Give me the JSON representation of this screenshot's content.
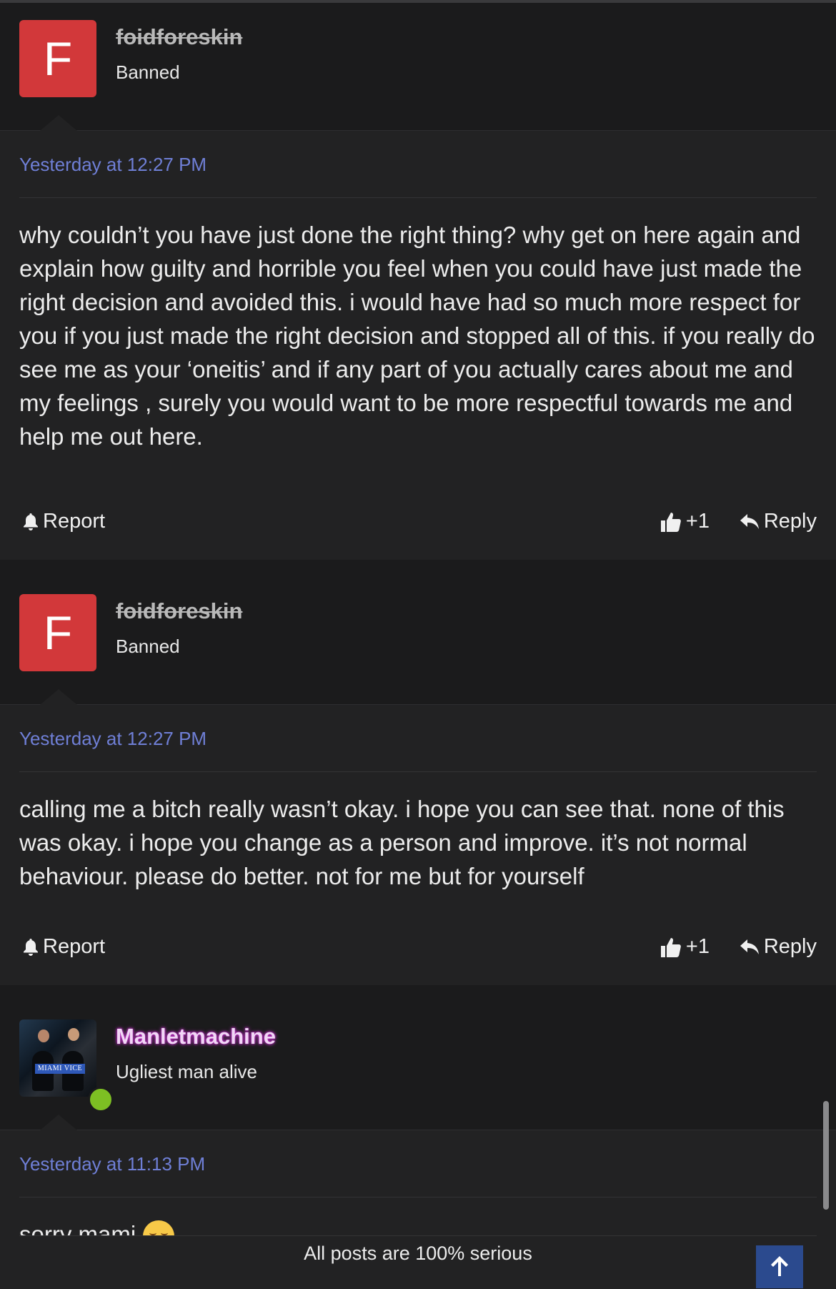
{
  "posts": [
    {
      "avatar_letter": "F",
      "username": "foidforeskin",
      "user_title": "Banned",
      "timestamp": "Yesterday at 12:27 PM",
      "body": "why couldn’t you have just done the right thing? why get on here again and explain how guilty and horrible you feel when you could have just made the right decision and avoided this. i would have had so much more respect for you if you just made the right decision and stopped all of this. if you really do see me as your ‘oneitis’ and if any part of you actually cares about me and my feelings , surely you would want to be more respectful towards me and help me out here.",
      "report_label": "Report",
      "like_label": "+1",
      "reply_label": "Reply"
    },
    {
      "avatar_letter": "F",
      "username": "foidforeskin",
      "user_title": "Banned",
      "timestamp": "Yesterday at 12:27 PM",
      "body": "calling me a bitch really wasn’t okay. i hope you can see that. none of this was okay. i hope you change as a person and improve. it’s not normal behaviour. please do better. not for me but for yourself",
      "report_label": "Report",
      "like_label": "+1",
      "reply_label": "Reply"
    },
    {
      "avatar_badge": "MIAMI VICE",
      "username": "Manletmachine",
      "user_title": "Ugliest man alive",
      "timestamp": "Yesterday at 11:13 PM",
      "body": "sorry mami",
      "online": true
    }
  ],
  "footer": {
    "text": "All posts are 100% serious"
  },
  "colors": {
    "background": "#1b1b1c",
    "post_background": "#222223",
    "avatar_red": "#d2383a",
    "timestamp_blue": "#6f7fd6",
    "online_green": "#7dbf23",
    "scroll_top_blue": "#2b4a8e"
  },
  "icons": [
    "bell-icon",
    "thumbs-up-icon",
    "reply-arrow-icon",
    "arrow-up-icon",
    "blushing-face-emoji"
  ]
}
